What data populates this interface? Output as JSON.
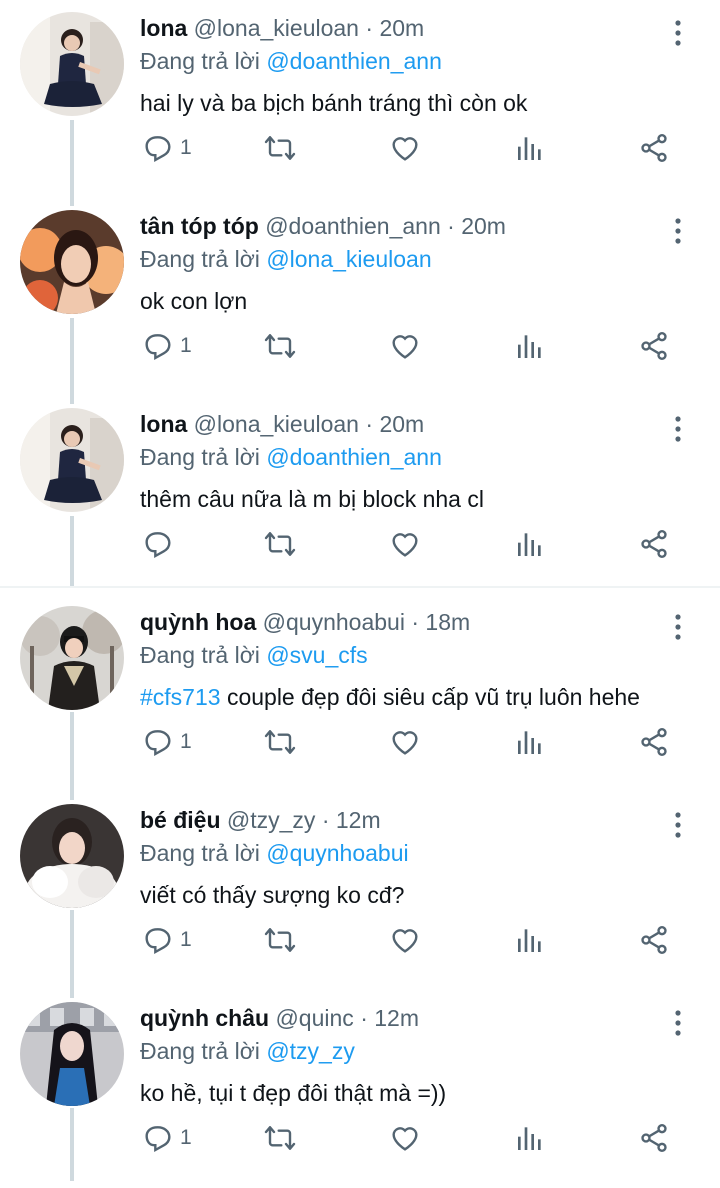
{
  "reply_prefix": "Đang trả lời",
  "tweets": [
    {
      "name": "lona",
      "handle": "@lona_kieuloan",
      "dot": "·",
      "time": "20m",
      "reply_to": "@doanthien_ann",
      "text": "hai ly và ba bịch bánh tráng thì còn ok",
      "hashtag": "",
      "reply_count": "1",
      "avatar": "avatar-lona"
    },
    {
      "name": "tân tóp tóp",
      "handle": "@doanthien_ann",
      "dot": "·",
      "time": "20m",
      "reply_to": "@lona_kieuloan",
      "text": "ok con lợn",
      "hashtag": "",
      "reply_count": "1",
      "avatar": "avatar-tan"
    },
    {
      "name": "lona",
      "handle": "@lona_kieuloan",
      "dot": "·",
      "time": "20m",
      "reply_to": "@doanthien_ann",
      "text": "thêm câu nữa là m bị block nha cl",
      "hashtag": "",
      "reply_count": "",
      "avatar": "avatar-lona"
    },
    {
      "name": "quỳnh hoa",
      "handle": "@quynhoabui",
      "dot": "·",
      "time": "18m",
      "reply_to": "@svu_cfs",
      "text": " couple đẹp đôi siêu cấp vũ trụ luôn hehe",
      "hashtag": "#cfs713",
      "reply_count": "1",
      "avatar": "avatar-hoa"
    },
    {
      "name": "bé điệu",
      "handle": "@tzy_zy",
      "dot": "·",
      "time": "12m",
      "reply_to": "@quynhoabui",
      "text": "viết có thấy sượng ko cđ?",
      "hashtag": "",
      "reply_count": "1",
      "avatar": "avatar-dieu"
    },
    {
      "name": "quỳnh châu",
      "handle": "@quinc",
      "dot": "·",
      "time": "12m",
      "reply_to": "@tzy_zy",
      "text": "ko hề, tụi t đẹp đôi thật mà =))",
      "hashtag": "",
      "reply_count": "1",
      "avatar": "avatar-chau"
    }
  ],
  "icons": {
    "reply": "reply-icon",
    "retweet": "retweet-icon",
    "like": "heart-icon",
    "views": "analytics-icon",
    "share": "share-icon",
    "more": "more-vertical-icon"
  },
  "colors": {
    "link": "#1d9bf0",
    "muted": "#536471",
    "text": "#0f1419",
    "thread_line": "#cfd9de"
  }
}
